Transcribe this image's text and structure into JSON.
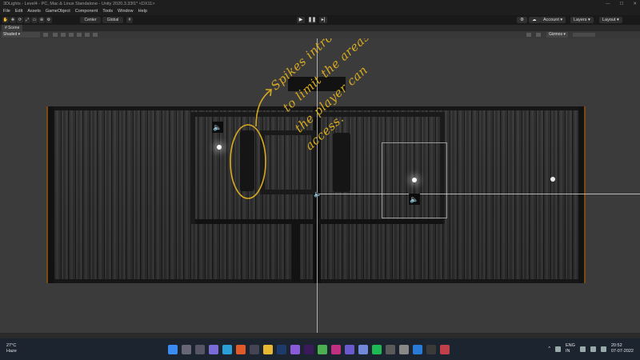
{
  "window": {
    "title": "3DLights - Level4 - PC, Mac & Linux Standalone - Unity 2020.3.33f1* <DX11>"
  },
  "menu": [
    "File",
    "Edit",
    "Assets",
    "GameObject",
    "Component",
    "Tools",
    "Window",
    "Help"
  ],
  "toolbar": {
    "pivot_label": "Center",
    "space_label": "Global",
    "account_label": "Account",
    "layers_label": "Layers",
    "layout_label": "Layout"
  },
  "scene_tab": {
    "label": "Scene"
  },
  "scene_bar": {
    "shading_label": "Shaded",
    "gizmos_label": "Gizmos"
  },
  "annotation": {
    "lines": [
      "Spikes introduced",
      "to limit the areas",
      "the player can",
      "access."
    ],
    "color": "#d8aa20"
  },
  "taskbar": {
    "weather_temp": "27°C",
    "weather_desc": "Haze",
    "lang_top": "ENG",
    "lang_bottom": "IN",
    "time": "20:52",
    "date": "07-07-2022"
  },
  "colors": {
    "wall_trim": "#7a4a10",
    "floor": "#2f2f2f",
    "annotation": "#d8aa20"
  }
}
